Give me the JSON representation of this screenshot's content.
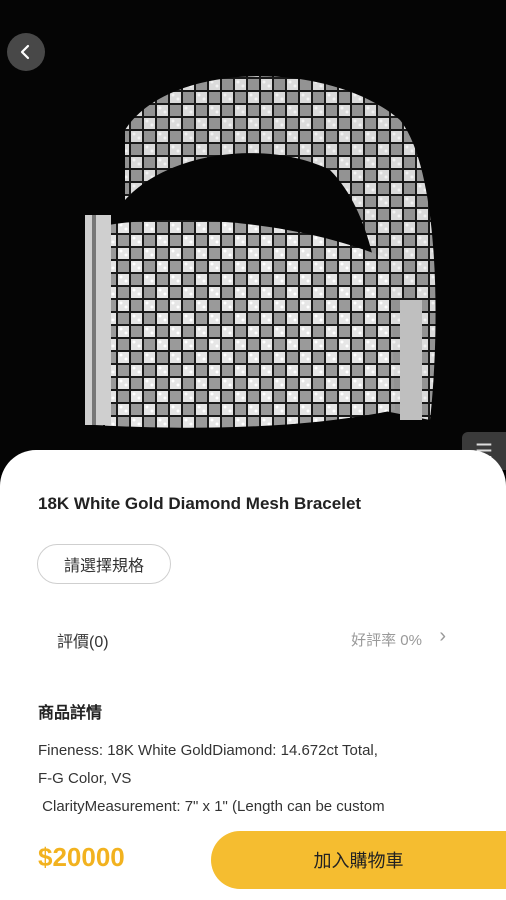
{
  "product": {
    "title": "18K White Gold Diamond Mesh Bracelet",
    "spec_label": "請選擇規格",
    "reviews_label": "評價(0)",
    "positive_rate": "好評率 0%",
    "details_title": "商品詳情",
    "details_text": "Fineness: 18K White GoldDiamond: 14.672ct Total,\nF-G Color, VS\n ClarityMeasurement: 7\" x 1\" (Length can be custom",
    "price": "$20000",
    "add_to_cart": "加入購物車"
  },
  "icons": {
    "back": "chevron-left-icon",
    "review_more": "chevron-right-icon"
  },
  "colors": {
    "accent": "#f5bd30",
    "price": "#f2b21f"
  }
}
